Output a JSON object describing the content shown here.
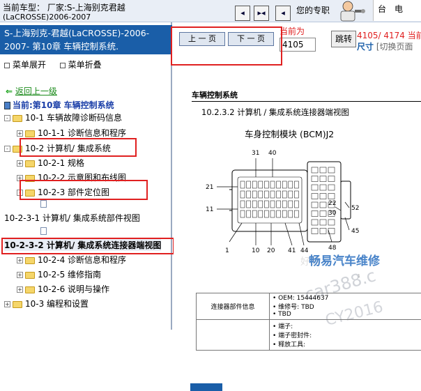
{
  "topbar": {
    "vehicle_line1": "当前车型：  厂家:S-上海别克君越",
    "vehicle_line2": "(LaCROSSE)2006-2007",
    "nav_buttons": [
      "◂",
      "▸◂",
      "◂"
    ],
    "favorite": "您的专职",
    "logo_text": "台　电"
  },
  "left": {
    "header": "S-上海别克-君越(LaCROSSE)-2006-2007- 第10章 车辆控制系统.",
    "menu_expand": "菜单展开",
    "menu_collapse": "菜单折叠",
    "back": "返回上一级",
    "current": "当前:第10章 车辆控制系统",
    "tree": [
      {
        "label": "10-1 车辆故障诊断码信息",
        "level": 0,
        "kind": "folder",
        "toggle": "-"
      },
      {
        "label": "10-1-1 诊断信息和程序",
        "level": 1,
        "kind": "folder",
        "toggle": "+"
      },
      {
        "label": "10-2 计算机/ 集成系统",
        "level": 0,
        "kind": "folder",
        "toggle": "-"
      },
      {
        "label": "10-2-1 规格",
        "level": 1,
        "kind": "folder",
        "toggle": "+"
      },
      {
        "label": "10-2-2 示意图和布线图",
        "level": 1,
        "kind": "folder",
        "toggle": "+"
      },
      {
        "label": "10-2-3 部件定位图",
        "level": 1,
        "kind": "folder",
        "toggle": "-"
      },
      {
        "label": "",
        "level": 2,
        "kind": "doc",
        "toggle": ""
      },
      {
        "label": "10-2-3-1 计算机/ 集成系统部件视图",
        "level": 0,
        "kind": "text",
        "toggle": ""
      },
      {
        "label": "",
        "level": 2,
        "kind": "doc",
        "toggle": ""
      },
      {
        "label": "10-2-3-2 计算机/ 集成系统连接器端视图",
        "level": 0,
        "kind": "text-selected",
        "toggle": ""
      },
      {
        "label": "10-2-4 诊断信息和程序",
        "level": 1,
        "kind": "folder",
        "toggle": "+"
      },
      {
        "label": "10-2-5 维修指南",
        "level": 1,
        "kind": "folder",
        "toggle": "+"
      },
      {
        "label": "10-2-6 说明与操作",
        "level": 1,
        "kind": "folder",
        "toggle": "+"
      },
      {
        "label": "10-3 编程和设置",
        "level": 0,
        "kind": "folder",
        "toggle": "+"
      }
    ]
  },
  "pager": {
    "prev": "上 一 页",
    "next": "下 一 页",
    "page_label": "当前为",
    "page_value": "4105",
    "jump": "跳转",
    "page_count": "4105/ 4174 当前",
    "size": "尺寸",
    "switch": "[切换页面"
  },
  "doc": {
    "section": "车辆控制系统",
    "subtitle": "10.2.3.2 计算机 / 集成系统连接器端视图",
    "caption": "车身控制模块 (BCM)J2",
    "pin_labels": [
      "31",
      "40",
      "21",
      "11",
      "1",
      "10",
      "20",
      "41",
      "44",
      "48",
      "45",
      "52",
      "22",
      "30"
    ],
    "figure_id": "1",
    "table": {
      "row1_label": "连接器部件信息",
      "row1_items": [
        "OEM: 15444637",
        "维修号: TBD",
        "TBD"
      ],
      "row2_items": [
        "端子:",
        "端子密封件:",
        "释放工具:"
      ]
    },
    "watermarks": [
      "畅易汽车维修",
      "car388.c",
      "CY2016",
      "好易"
    ]
  }
}
